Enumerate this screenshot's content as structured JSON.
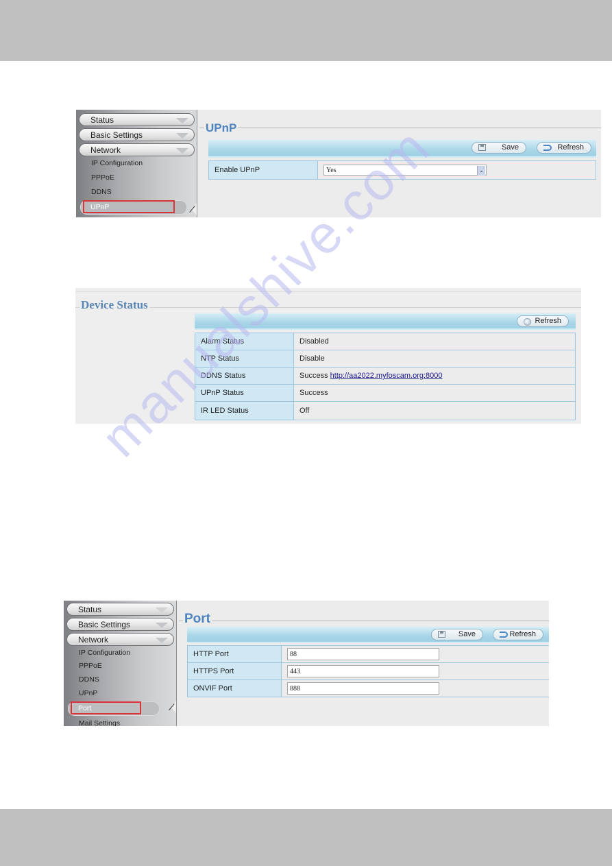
{
  "watermark": "manualshive.com",
  "upnp_shot": {
    "sidebar": {
      "menus": [
        {
          "label": "Status"
        },
        {
          "label": "Basic Settings"
        },
        {
          "label": "Network"
        }
      ],
      "sub_items": [
        "IP Configuration",
        "PPPoE",
        "DDNS"
      ],
      "active_item": "UPnP"
    },
    "title": "UPnP",
    "toolbar": {
      "save_label": "Save",
      "refresh_label": "Refresh"
    },
    "form": {
      "label": "Enable UPnP",
      "value": "Yes"
    }
  },
  "status_shot": {
    "title": "Device Status",
    "toolbar": {
      "refresh_label": "Refresh"
    },
    "rows": [
      {
        "label": "Alarm Status",
        "value": "Disabled"
      },
      {
        "label": "NTP Status",
        "value": "Disable"
      },
      {
        "label": "DDNS Status",
        "value": "Success",
        "link": "http://aa2022.myfoscam.org:8000"
      },
      {
        "label": "UPnP Status",
        "value": "Success"
      },
      {
        "label": "IR LED Status",
        "value": "Off"
      }
    ]
  },
  "port_shot": {
    "sidebar": {
      "menus": [
        {
          "label": "Status"
        },
        {
          "label": "Basic Settings"
        },
        {
          "label": "Network"
        }
      ],
      "sub_items": [
        "IP Configuration",
        "PPPoE",
        "DDNS",
        "UPnP"
      ],
      "active_item": "Port",
      "after_items": [
        "Mail Settings"
      ]
    },
    "title": "Port",
    "toolbar": {
      "save_label": "Save",
      "refresh_label": "Refresh"
    },
    "rows": [
      {
        "label": "HTTP Port",
        "value": "88"
      },
      {
        "label": "HTTPS Port",
        "value": "443"
      },
      {
        "label": "ONVIF Port",
        "value": "888"
      }
    ]
  }
}
